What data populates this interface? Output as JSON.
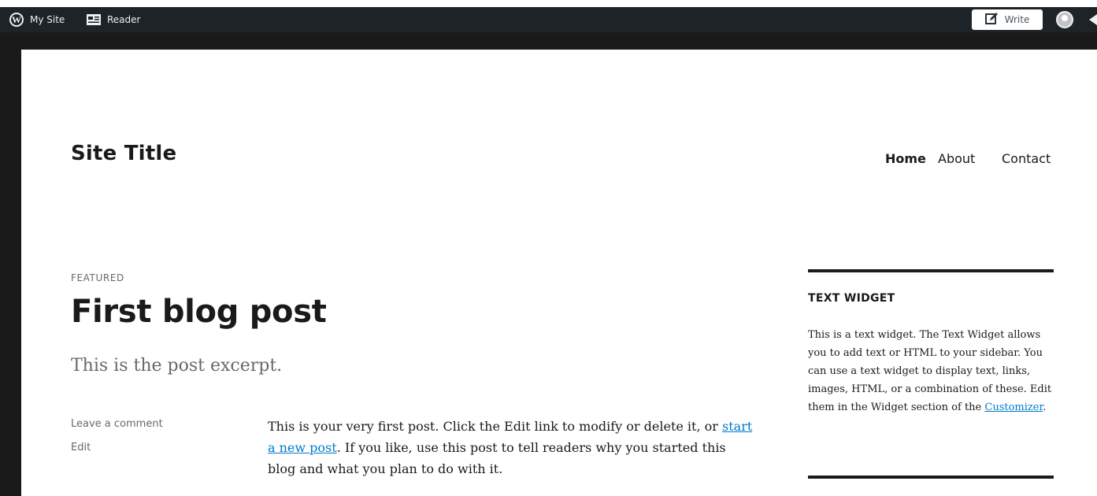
{
  "admin_bar": {
    "my_site_label": "My Site",
    "reader_label": "Reader",
    "write_label": "Write",
    "background_color": "#1d2327"
  },
  "header": {
    "site_title": "Site Title",
    "nav": [
      {
        "label": "Home",
        "active": true
      },
      {
        "label": "About",
        "active": false
      },
      {
        "label": "Contact",
        "active": false
      }
    ]
  },
  "post": {
    "kicker": "FEATURED",
    "title": "First blog post",
    "excerpt": "This is the post excerpt.",
    "meta": {
      "comment_link": "Leave a comment",
      "edit_link": "Edit"
    },
    "content": {
      "before_link": "This is your very first post. Click the Edit link to modify or delete it, or ",
      "link_text": "start a new post",
      "after_link": ". If you like, use this post to tell readers why you started this blog and what you plan to do with it."
    }
  },
  "sidebar": {
    "widget_title": "TEXT WIDGET",
    "widget_text_before": "This is a text widget. The Text Widget allows you to add text or HTML to your sidebar. You can use a text widget to display text, links, images, HTML, or a combination of these. Edit them in the Widget section of the ",
    "widget_link": "Customizer",
    "widget_text_after": "."
  },
  "colors": {
    "link": "#007acc",
    "text": "#1a1a1a",
    "muted": "#686868"
  }
}
